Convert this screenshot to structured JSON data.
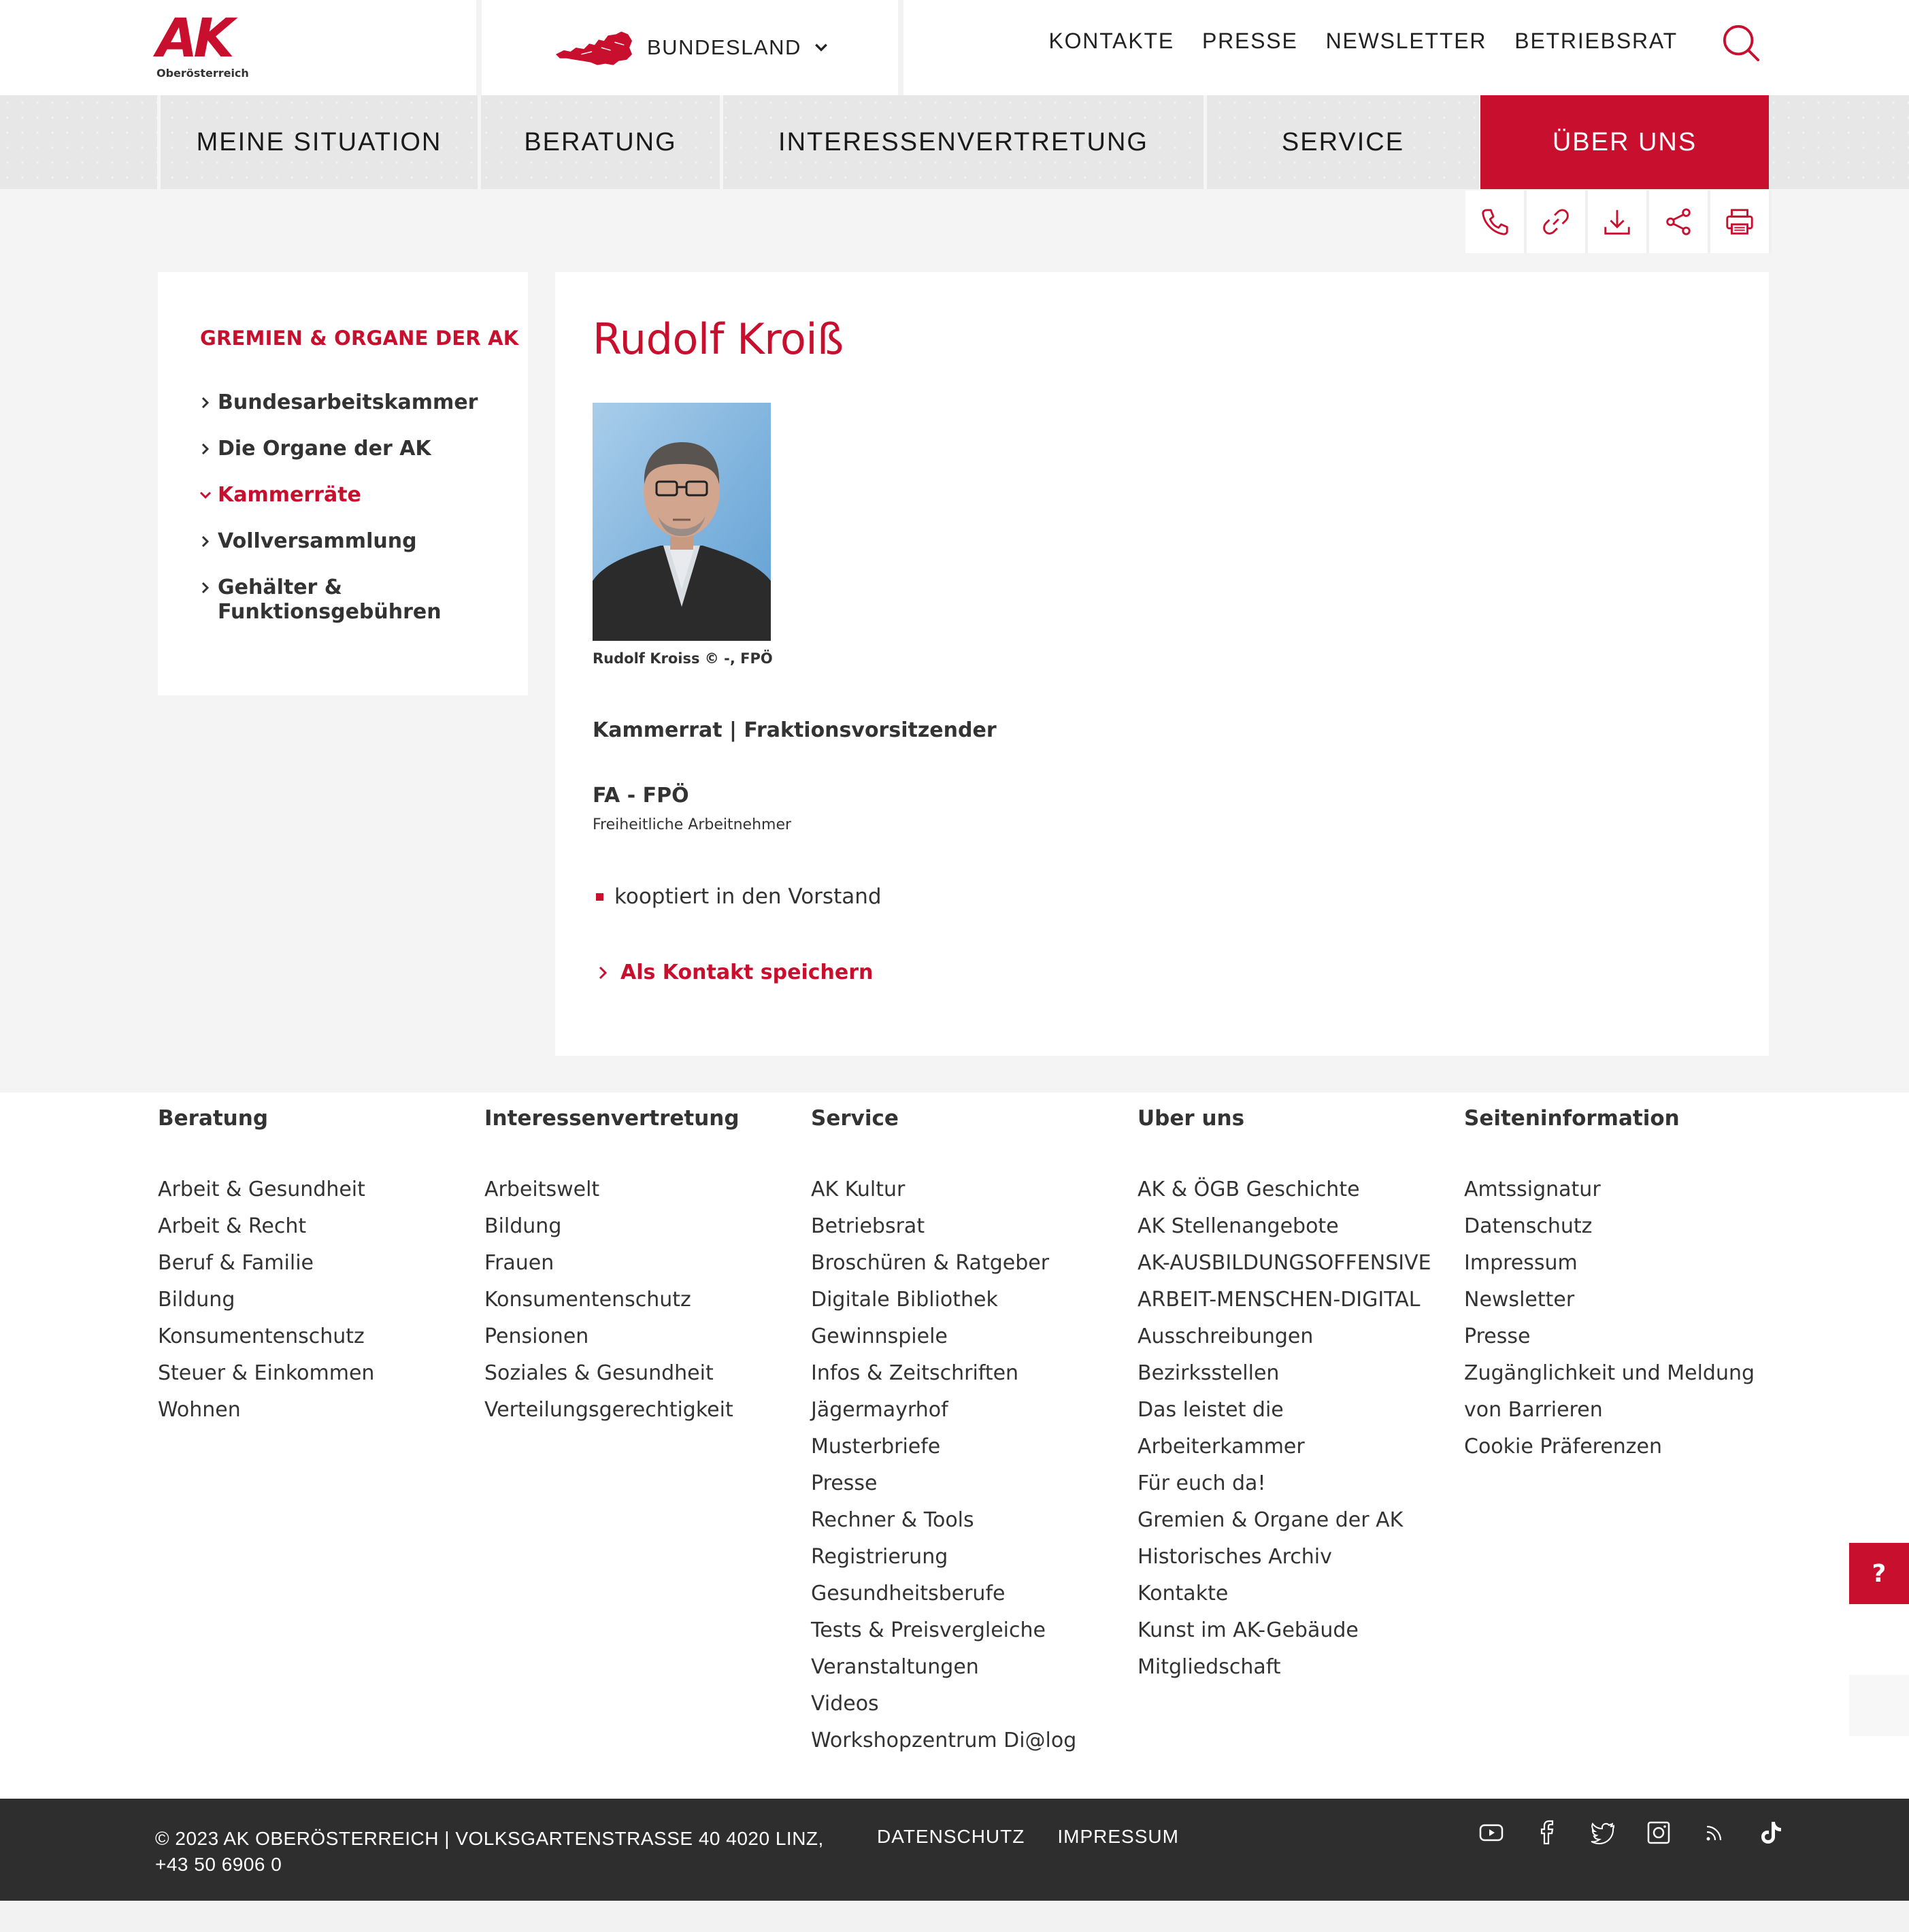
{
  "brand": {
    "logo_text": "AK",
    "region": "Oberösterreich",
    "accent_color": "#c8102e"
  },
  "header": {
    "bundesland_label": "BUNDESLAND",
    "top_links": [
      "KONTAKTE",
      "PRESSE",
      "NEWSLETTER",
      "BETRIEBSRAT"
    ]
  },
  "main_nav": {
    "items": [
      "MEINE SITUATION",
      "BERATUNG",
      "INTERESSENVERTRETUNG",
      "SERVICE",
      "ÜBER UNS"
    ],
    "active": "ÜBER UNS"
  },
  "toolbar": {
    "icons": [
      "phone-icon",
      "link-icon",
      "download-icon",
      "share-icon",
      "print-icon"
    ],
    "vcard_icon": "contact-card-icon"
  },
  "sidebar": {
    "title": "GREMIEN & ORGANE DER AK",
    "items": [
      {
        "label": "Bundesarbeitskammer",
        "active": false
      },
      {
        "label": "Die Organe der AK",
        "active": false
      },
      {
        "label": "Kammerräte",
        "active": true
      },
      {
        "label": "Vollversammlung",
        "active": false
      },
      {
        "label": "Gehälter & Funktionsgebühren",
        "active": false
      }
    ]
  },
  "profile": {
    "name": "Rudolf Kroiß",
    "photo_caption": "Rudolf Kroiss © -, FPÖ",
    "role": "Kammerrat | Fraktionsvorsitzender",
    "faction": "FA - FPÖ",
    "faction_full": "Freiheitliche Arbeitnehmer",
    "bullets": [
      "kooptiert in den Vorstand"
    ],
    "save_contact_label": "Als Kontakt speichern"
  },
  "footer": {
    "columns": [
      {
        "title": "Beratung",
        "links": [
          "Arbeit & Gesundheit",
          "Arbeit & Recht",
          "Beruf & Familie",
          "Bildung",
          "Konsumentenschutz",
          "Steuer & Einkommen",
          "Wohnen"
        ]
      },
      {
        "title": "Interessenvertretung",
        "links": [
          "Arbeitswelt",
          "Bildung",
          "Frauen",
          "Konsumentenschutz",
          "Pensionen",
          "Soziales & Gesundheit",
          "Verteilungsgerechtigkeit"
        ]
      },
      {
        "title": "Service",
        "links": [
          "AK Kultur",
          "Betriebsrat",
          "Broschüren & Ratgeber",
          "Digitale Bibliothek",
          "Gewinnspiele",
          "Infos & Zeitschriften",
          "Jägermayrhof",
          "Musterbriefe",
          "Presse",
          "Rechner & Tools",
          "Registrierung",
          "Gesundheitsberufe",
          "Tests & Preisvergleiche",
          "Veranstaltungen",
          "Videos",
          "Workshopzentrum Di@log"
        ]
      },
      {
        "title": "Uber uns",
        "links": [
          "AK & ÖGB Geschichte",
          "AK Stellenangebote",
          "AK-AUSBILDUNGSOFFENSIVE",
          "ARBEIT-MENSCHEN-DIGITAL",
          "Ausschreibungen",
          "Bezirksstellen",
          "Das leistet die",
          "Arbeiterkammer",
          "Für euch da!",
          "Gremien & Organe der AK",
          "Historisches Archiv",
          "Kontakte",
          "Kunst im AK-Gebäude",
          "Mitgliedschaft"
        ]
      },
      {
        "title": "Seiteninformation",
        "links": [
          "Amtssignatur",
          "Datenschutz",
          "Impressum",
          "Newsletter",
          "Presse",
          "Zugänglichkeit und Meldung",
          "von Barrieren",
          "Cookie Präferenzen"
        ]
      }
    ]
  },
  "floating": {
    "help_label": "?"
  },
  "bottom_bar": {
    "copyright": "© 2023 AK OBERÖSTERREICH | VOLKSGARTENSTRASSE 40 4020 LINZ, +43 50 6906 0",
    "links": [
      "DATENSCHUTZ",
      "IMPRESSUM"
    ],
    "social_icons": [
      "youtube-icon",
      "facebook-icon",
      "twitter-icon",
      "instagram-icon",
      "rss-icon",
      "tiktok-icon"
    ]
  }
}
